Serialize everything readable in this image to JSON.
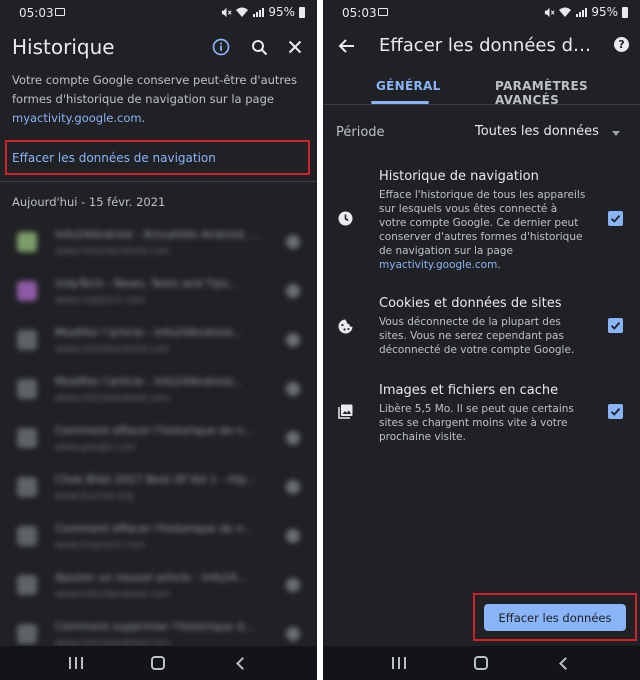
{
  "left_screen": {
    "status": {
      "time": "05:03",
      "battery": "95%"
    },
    "header": {
      "title": "Historique"
    },
    "description": {
      "text": "Votre compte Google conserve peut-être d'autres formes d'historique de navigation sur la page ",
      "link": "myactivity.google.com",
      "suffix": "."
    },
    "clear_link": "Effacer les données de navigation",
    "date_header": "Aujourd'hui - 15 févr. 2021",
    "history_items": [
      {
        "title": "Info24Android - Actualités Android, ...",
        "url": "www.info24android.com"
      },
      {
        "title": "IndyTech - News, Tests and Tips...",
        "url": "www.indytech.com"
      },
      {
        "title": "Modifier l'article - Info24Android...",
        "url": "www.info24android.com"
      },
      {
        "title": "Modifier l'article - Info24Android...",
        "url": "www.info24android.com"
      },
      {
        "title": "Comment effacer l'historique de n...",
        "url": "www.google.com"
      },
      {
        "title": "Chek Bilet 2017 Best Of Vol 1 - Hip...",
        "url": "www.fourrde.org"
      },
      {
        "title": "Comment effacer l'historique de n...",
        "url": "www.indytech.com"
      },
      {
        "title": "Ajouter un nouvel article - Info24...",
        "url": "www.info24android.com"
      },
      {
        "title": "Comment supprimer l'historique d...",
        "url": "www.info24android.com"
      }
    ]
  },
  "right_screen": {
    "status": {
      "time": "05:03",
      "battery": "95%"
    },
    "header": {
      "title": "Effacer les données de navigation"
    },
    "tabs": [
      {
        "label": "GÉNÉRAL",
        "active": true
      },
      {
        "label": "PARAMÈTRES AVANCÉS",
        "active": false
      }
    ],
    "period": {
      "label": "Période",
      "value": "Toutes les données"
    },
    "options": [
      {
        "icon": "clock-icon",
        "title": "Historique de navigation",
        "description": "Efface l'historique de tous les appareils sur lesquels vous êtes connecté à votre compte Google. Ce dernier peut conserver d'autres formes d'historique de navigation sur la page ",
        "link": "myactivity.google.com",
        "link_suffix": ".",
        "checked": true
      },
      {
        "icon": "cookie-icon",
        "title": "Cookies et données de sites",
        "description": "Vous déconnecte de la plupart des sites. Vous ne serez cependant pas déconnecté de votre compte Google.",
        "checked": true
      },
      {
        "icon": "image-icon",
        "title": "Images et fichiers en cache",
        "description": "Libère 5,5 Mo. Il se peut que certains sites se chargent moins vite à votre prochaine visite.",
        "checked": true
      }
    ],
    "clear_button": "Effacer les données"
  },
  "colors": {
    "background": "#202124",
    "text_primary": "#e8eaed",
    "text_secondary": "#bdc1c6",
    "accent": "#8ab4f8",
    "highlight": "#d0202c"
  }
}
